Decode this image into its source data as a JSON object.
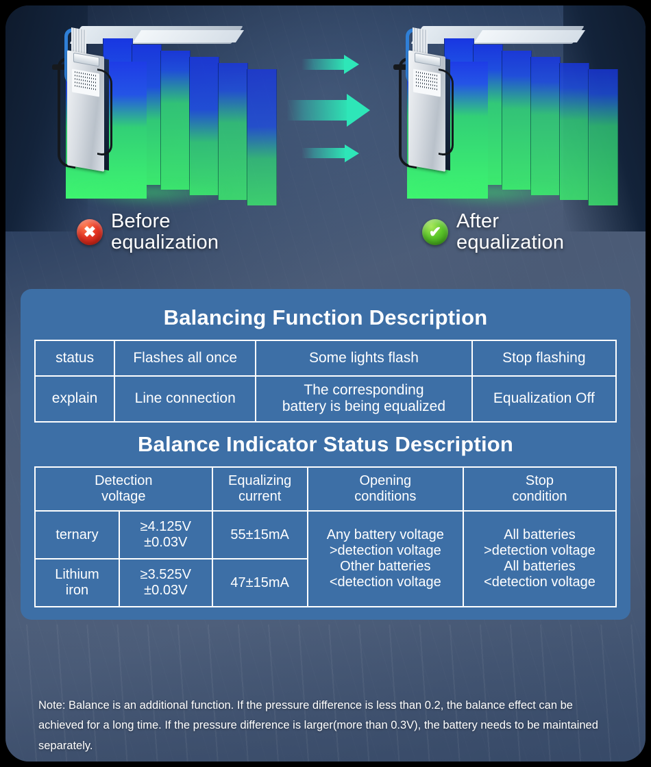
{
  "hero": {
    "before": {
      "badge_icon": "cross-icon",
      "line1": "Before",
      "line2": "equalization",
      "badge_glyph": "✖"
    },
    "after": {
      "badge_icon": "check-icon",
      "line1": "After",
      "line2": "equalization",
      "badge_glyph": "✔"
    },
    "arrows_icon": "arrow-right-icon"
  },
  "panel": {
    "title_1": "Balancing Function Description",
    "title_2": "Balance Indicator Status Description",
    "table_1": {
      "rows": [
        {
          "label": "status",
          "c1": "Flashes all once",
          "c2": "Some lights flash",
          "c3": "Stop flashing"
        },
        {
          "label": "explain",
          "c1": "Line connection",
          "c2_l1": "The corresponding",
          "c2_l2": "battery is being equalized",
          "c3": "Equalization Off"
        }
      ]
    },
    "table_2": {
      "headers": {
        "detection_voltage_l1": "Detection",
        "detection_voltage_l2": "voltage",
        "equalizing_current_l1": "Equalizing",
        "equalizing_current_l2": "current",
        "opening_conditions_l1": "Opening",
        "opening_conditions_l2": "conditions",
        "stop_condition_l1": "Stop",
        "stop_condition_l2": "condition"
      },
      "rows": [
        {
          "type": "ternary",
          "type_l1": "ternary",
          "type_l2": "",
          "voltage_l1": "≥4.125V",
          "voltage_l2": "±0.03V",
          "current": "55±15mA"
        },
        {
          "type": "Lithium iron",
          "type_l1": "Lithium",
          "type_l2": "iron",
          "voltage_l1": "≥3.525V",
          "voltage_l2": "±0.03V",
          "current": "47±15mA"
        }
      ],
      "opening_conditions": {
        "l1": "Any battery voltage",
        "l2": ">detection voltage",
        "l3": "Other batteries",
        "l4": "<detection voltage"
      },
      "stop_condition": {
        "l1": "All batteries",
        "l2": ">detection voltage",
        "l3": "All batteries",
        "l4": "<detection voltage"
      }
    }
  },
  "note": {
    "text": "Note: Balance is an additional function. If the pressure difference is less than 0.2, the balance effect can be achieved for a long time. If the pressure difference is larger(more than 0.3V), the battery needs to be maintained separately."
  },
  "colors": {
    "panel_blue": "#3d6fa6",
    "border_white": "#ffffff",
    "arrow_teal": "#2ee6b8",
    "cell_green": "#3beb6e",
    "cell_blue": "#2244e8",
    "badge_red": "#e53524",
    "badge_green": "#5cc62a",
    "background_dark": "#15233a"
  }
}
